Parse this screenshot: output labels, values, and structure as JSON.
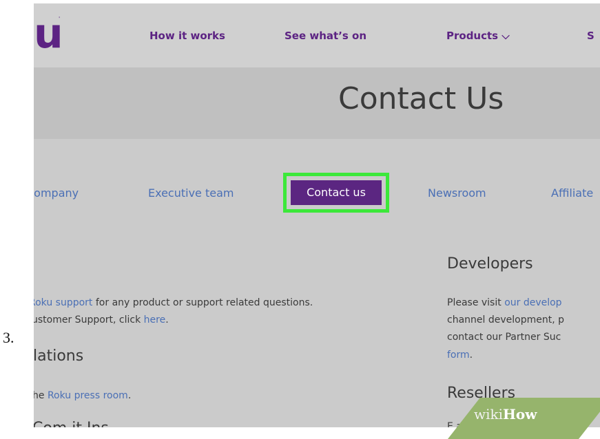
{
  "step_number": "3.",
  "nav": {
    "logo": "u",
    "logo_mark": "'",
    "items": [
      "How it works",
      "See what’s on",
      "Products ⌵",
      "S"
    ]
  },
  "hero": {
    "title": "Contact Us"
  },
  "subnav": {
    "items": [
      "Company",
      "Executive team",
      "Contact us",
      "Newsroom",
      "Affiliate"
    ],
    "active_index": 2
  },
  "content": {
    "support_line1_link": "Roku support",
    "support_line1_rest": " for any product or support related questions.",
    "support_line2_text": "ustomer Support, click ",
    "support_line2_link": "here",
    "support_line2_end": ".",
    "relations_heading": "lations",
    "press_text": "he ",
    "press_link": "Roku press room",
    "press_end": ".",
    "bottom_cut_text": "Com it Ins"
  },
  "developers": {
    "heading": "Developers",
    "line1_text": "Please visit ",
    "line1_link": "our develop",
    "line2": "channel development, p",
    "line3": "contact our Partner Suc",
    "line4_link": "form",
    "line4_end": "."
  },
  "resellers": {
    "heading": "Resellers",
    "cut_text": "E ail    ll   @   k"
  },
  "watermark": {
    "wiki": "wiki",
    "how": "How"
  },
  "colors": {
    "purple": "#5b2681",
    "link_blue": "#4a6fb5",
    "highlight_green": "#3ce83a"
  }
}
